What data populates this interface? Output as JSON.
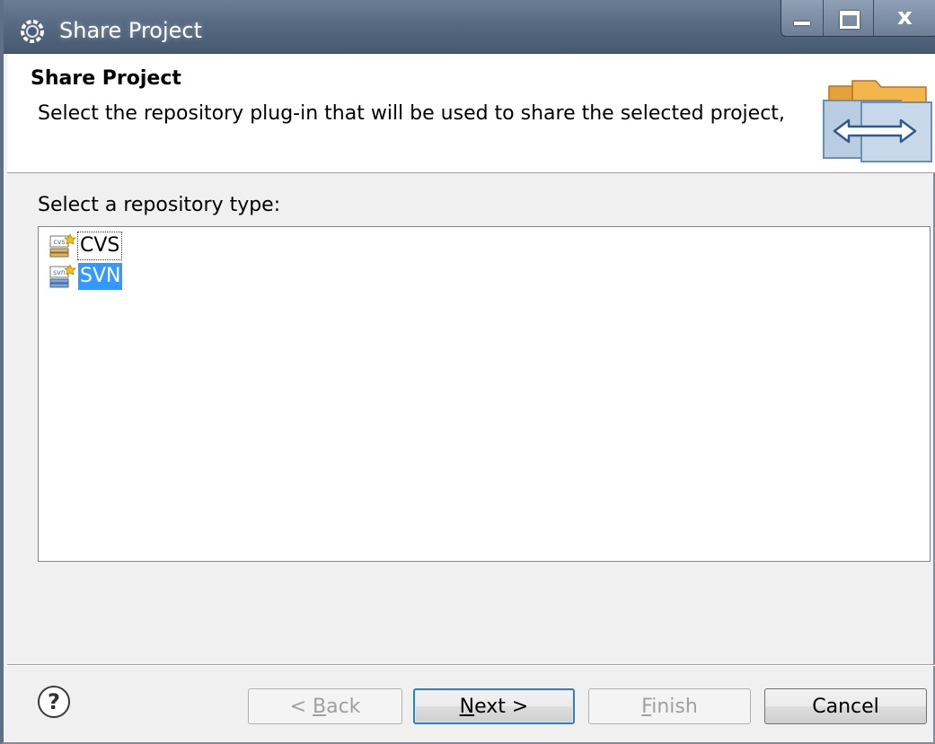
{
  "window": {
    "title": "Share Project",
    "icon": "eclipse-gear-icon"
  },
  "banner": {
    "title": "Share Project",
    "description": "Select the repository plug-in that will be used to share the selected project,",
    "icon": "share-folders-arrows-icon"
  },
  "body": {
    "label": "Select a repository type:"
  },
  "repository_types": [
    {
      "label": "CVS",
      "icon": "cvs-repository-icon",
      "state": "focused"
    },
    {
      "label": "SVN",
      "icon": "svn-repository-icon",
      "state": "selected"
    }
  ],
  "buttons": {
    "help_icon": "?",
    "back_prefix": "< ",
    "back_mnemonic": "B",
    "back_rest": "ack",
    "next_mnemonic": "N",
    "next_rest": "ext >",
    "finish_mnemonic": "F",
    "finish_rest": "inish",
    "cancel": "Cancel"
  },
  "colors": {
    "selection": "#3399ff",
    "titlebar": "#566a82"
  }
}
